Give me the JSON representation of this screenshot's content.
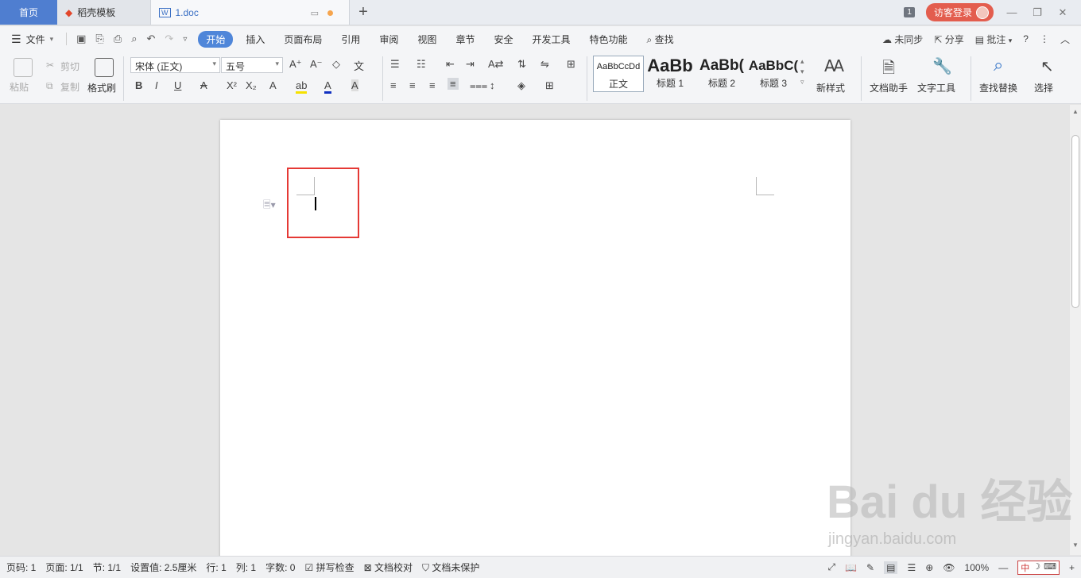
{
  "tabs": {
    "home": "首页",
    "template": "稻壳模板",
    "doc": "1.doc",
    "new": "+"
  },
  "titlebar": {
    "badge": "1",
    "login": "访客登录",
    "minimize": "—",
    "restore": "❐",
    "close": "✕"
  },
  "menu": {
    "file": "文件",
    "items": [
      "开始",
      "插入",
      "页面布局",
      "引用",
      "审阅",
      "视图",
      "章节",
      "安全",
      "开发工具",
      "特色功能"
    ],
    "search": "查找",
    "sync": "未同步",
    "share": "分享",
    "comment": "批注",
    "help": "?",
    "more": "⋮",
    "collapse": "︿"
  },
  "ribbon": {
    "paste": "粘贴",
    "cut": "剪切",
    "copy": "复制",
    "format_painter": "格式刷",
    "font_name": "宋体 (正文)",
    "font_size": "五号",
    "styles": [
      {
        "preview": "AaBbCcDd",
        "name": "正文"
      },
      {
        "preview": "AaBb",
        "name": "标题 1"
      },
      {
        "preview": "AaBb(",
        "name": "标题 2"
      },
      {
        "preview": "AaBbC(",
        "name": "标题 3"
      }
    ],
    "new_style": "新样式",
    "doc_helper": "文档助手",
    "text_tools": "文字工具",
    "find_replace": "查找替换",
    "select": "选择"
  },
  "status": {
    "page_no": "页码: 1",
    "page": "页面: 1/1",
    "section": "节: 1/1",
    "setting": "设置值: 2.5厘米",
    "row": "行: 1",
    "col": "列: 1",
    "word_count": "字数: 0",
    "spell": "拼写检查",
    "proof": "文档校对",
    "protect": "文档未保护",
    "zoom": "100%"
  },
  "watermark": {
    "brand": "Bai du 经验",
    "url": "jingyan.baidu.com"
  }
}
